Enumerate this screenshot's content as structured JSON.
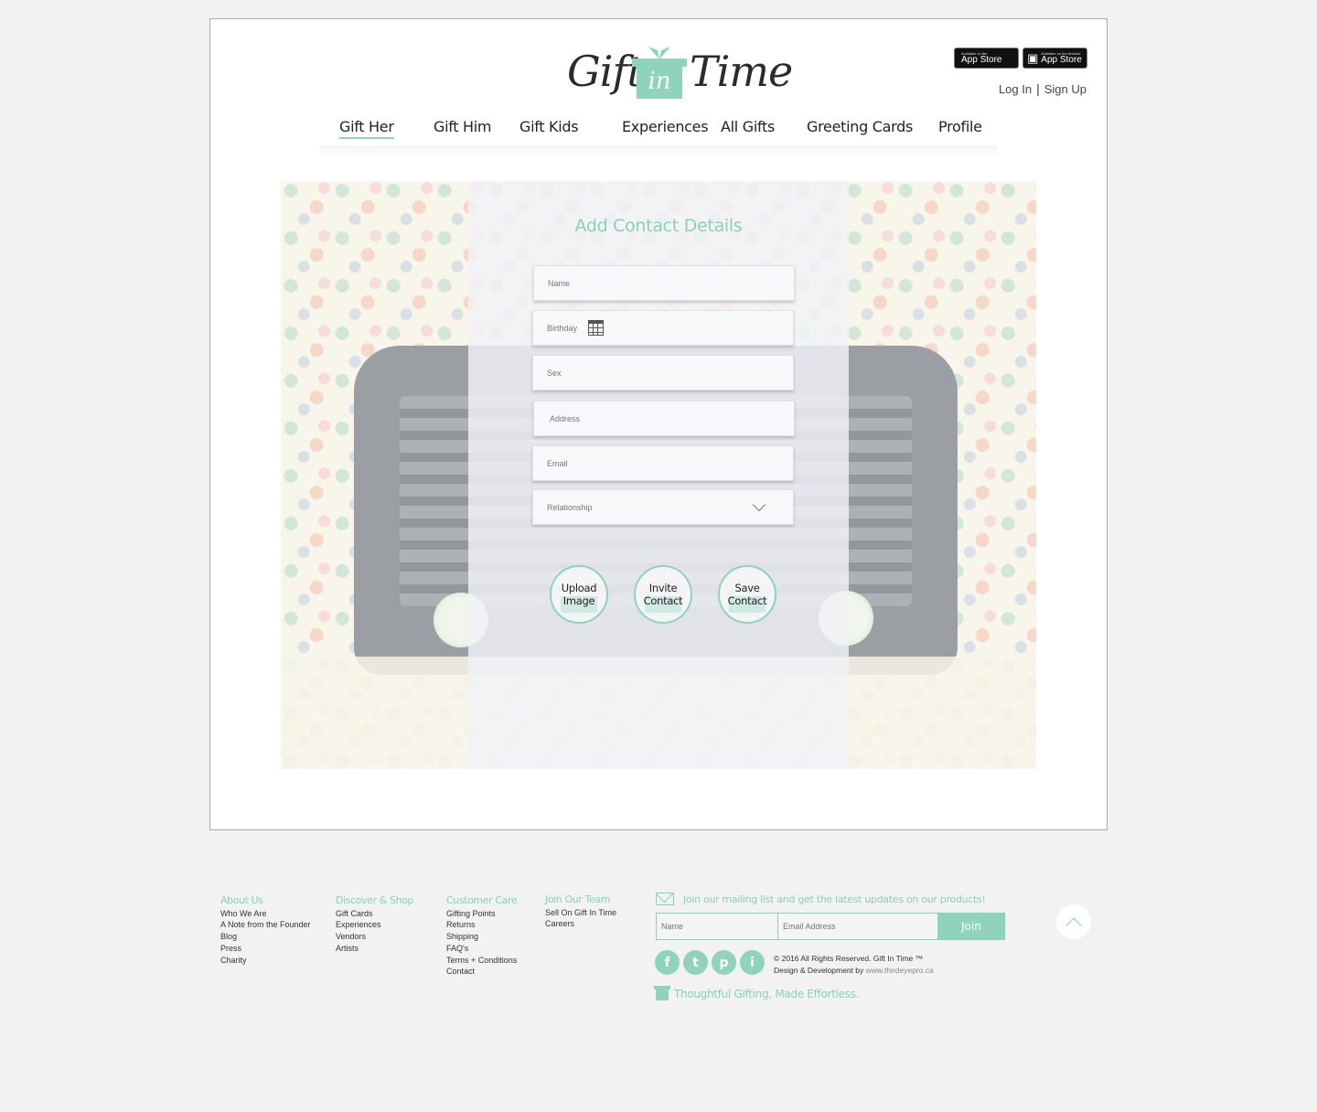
{
  "brand": {
    "logo_word1": "Gift",
    "logo_word_in": "in",
    "logo_word2": "Time",
    "accent": "#8fd3bd"
  },
  "header": {
    "app_store": {
      "small": "Available on the",
      "big": "App Store",
      "icon": "apple-icon"
    },
    "android_store": {
      "small": "Available on the Android",
      "big": "App Store",
      "icon": "android-icon"
    },
    "login": "Log In",
    "separator": "|",
    "signup": "Sign Up"
  },
  "nav": {
    "items": [
      {
        "label": "Gift Her",
        "active": true
      },
      {
        "label": "Gift Him"
      },
      {
        "label": "Gift Kids"
      },
      {
        "label": "Experiences"
      },
      {
        "label": "All Gifts"
      },
      {
        "label": "Greeting Cards"
      },
      {
        "label": "Profile"
      }
    ]
  },
  "form": {
    "title": "Add Contact Details",
    "name_placeholder": "Name",
    "birthday_placeholder": "Birthday",
    "sex_placeholder": "Sex",
    "address_placeholder": "Address",
    "email_placeholder": "Email",
    "relationship_placeholder": "Relationship",
    "buttons": {
      "upload_line1": "Upload",
      "upload_line2": "Image",
      "invite_line1": "Invite",
      "invite_line2": "Contact",
      "save_line1": "Save",
      "save_line2": "Contact"
    }
  },
  "footer": {
    "about": {
      "title": "About Us",
      "links": [
        "Who We Are",
        "A Note from the Founder",
        "Blog",
        "Press",
        "Charity"
      ]
    },
    "discover": {
      "title": "Discover & Shop",
      "links": [
        "Gift Cards",
        "Experiences",
        "Vendors",
        "Artists"
      ]
    },
    "care": {
      "title": "Customer Care",
      "links": [
        "Gifting Points",
        "Returns",
        "Shipping",
        "FAQ's",
        "Terms + Conditions",
        "Contact"
      ]
    },
    "team": {
      "title": "Join Our Team",
      "links": [
        "Sell On Gift In Time",
        "Careers"
      ]
    },
    "mailing_text": "Join our mailing list and get the latest updates on our products!",
    "name_placeholder": "Name",
    "email_placeholder": "Email Address",
    "join_label": "Join",
    "social": [
      "f",
      "t",
      "p",
      "i"
    ],
    "copyright": "© 2016 All Rights Reserved. Gift In Time ™",
    "design_credit": "Design & Development by",
    "design_link": "www.thirdeyepro.ca",
    "tagline": "Thoughtful Gifting, Made Effortless."
  }
}
